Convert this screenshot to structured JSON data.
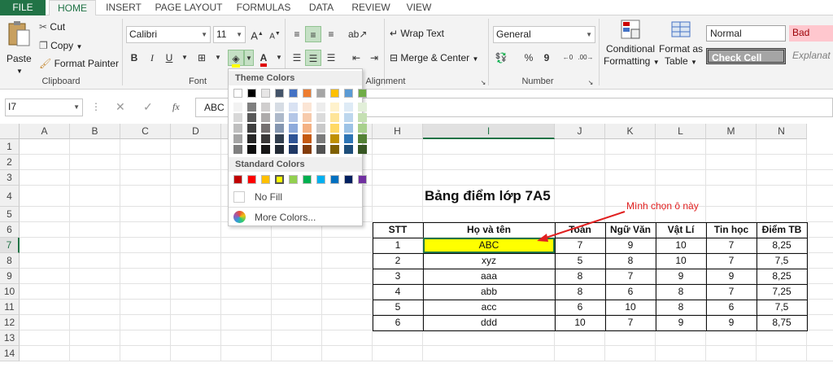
{
  "tabs": [
    "FILE",
    "HOME",
    "INSERT",
    "PAGE LAYOUT",
    "FORMULAS",
    "DATA",
    "REVIEW",
    "VIEW"
  ],
  "clipboard": {
    "paste": "Paste",
    "cut": "Cut",
    "copy": "Copy",
    "format_painter": "Format Painter",
    "label": "Clipboard"
  },
  "font": {
    "name": "Calibri",
    "size": "11",
    "bold": "B",
    "italic": "I",
    "underline": "U",
    "label": "Font",
    "grow": "A",
    "shrink": "A"
  },
  "alignment": {
    "wrap": "Wrap Text",
    "merge": "Merge & Center",
    "label": "Alignment"
  },
  "number": {
    "format": "General",
    "percent": "%",
    "comma": "9",
    "label": "Number"
  },
  "styles": {
    "conditional": "Conditional",
    "conditional2": "Formatting",
    "format_as": "Format as",
    "format_as2": "Table",
    "normal": "Normal",
    "bad": "Bad",
    "check_cell": "Check Cell",
    "explanatory": "Explanat"
  },
  "formula_bar": {
    "name_box": "I7",
    "fx": "fx",
    "value": "ABC"
  },
  "columns": [
    "A",
    "B",
    "C",
    "D",
    "E",
    "F",
    "G",
    "H",
    "I",
    "J",
    "K",
    "L",
    "M",
    "N"
  ],
  "rows": [
    "1",
    "2",
    "3",
    "4",
    "5",
    "6",
    "7",
    "8",
    "9",
    "10",
    "11",
    "12",
    "13",
    "14"
  ],
  "sheet": {
    "title": "Bảng điểm lớp 7A5",
    "annotation": "Mình chọn ô này",
    "headers": [
      "STT",
      "Họ và tên",
      "Toán",
      "Ngữ Văn",
      "Vật Lí",
      "Tin học",
      "Điểm TB"
    ],
    "rows": [
      [
        "1",
        "ABC",
        "7",
        "9",
        "10",
        "7",
        "8,25"
      ],
      [
        "2",
        "xyz",
        "5",
        "8",
        "10",
        "7",
        "7,5"
      ],
      [
        "3",
        "aaa",
        "8",
        "7",
        "9",
        "9",
        "8,25"
      ],
      [
        "4",
        "abb",
        "8",
        "6",
        "8",
        "7",
        "7,25"
      ],
      [
        "5",
        "acc",
        "6",
        "10",
        "8",
        "6",
        "7,5"
      ],
      [
        "6",
        "ddd",
        "10",
        "7",
        "9",
        "9",
        "8,75"
      ]
    ]
  },
  "color_menu": {
    "theme_label": "Theme Colors",
    "standard_label": "Standard Colors",
    "no_fill": "No Fill",
    "more_colors": "More Colors...",
    "theme_top": [
      "#ffffff",
      "#000000",
      "#e7e6e6",
      "#44546a",
      "#4472c4",
      "#ed7d31",
      "#a5a5a5",
      "#ffc000",
      "#5b9bd5",
      "#70ad47"
    ],
    "theme_shades": [
      [
        "#f2f2f2",
        "#7f7f7f",
        "#d0cece",
        "#d6dce4",
        "#d9e2f3",
        "#fbe5d5",
        "#ededed",
        "#fff2cc",
        "#deebf6",
        "#e2efd9"
      ],
      [
        "#d8d8d8",
        "#595959",
        "#aeabab",
        "#adb9ca",
        "#b4c6e7",
        "#f7cbac",
        "#dbdbdb",
        "#fee599",
        "#bdd7ee",
        "#c5e0b3"
      ],
      [
        "#bfbfbf",
        "#3f3f3f",
        "#757070",
        "#8496b0",
        "#8eaadb",
        "#f4b183",
        "#c9c9c9",
        "#ffd965",
        "#9dc3e6",
        "#a8d08d"
      ],
      [
        "#a5a5a5",
        "#262626",
        "#3a3838",
        "#323f4f",
        "#2f5496",
        "#c55a11",
        "#7b7b7b",
        "#bf9000",
        "#2e75b5",
        "#538135"
      ],
      [
        "#7f7f7f",
        "#0c0c0c",
        "#171616",
        "#222a35",
        "#1f3864",
        "#833c0b",
        "#525252",
        "#7f6000",
        "#1e4e79",
        "#375623"
      ]
    ],
    "standard": [
      "#c00000",
      "#ff0000",
      "#ffc000",
      "#ffff00",
      "#92d050",
      "#00b050",
      "#00b0f0",
      "#0070c0",
      "#002060",
      "#7030a0"
    ]
  },
  "colors": {
    "excel_green": "#217346",
    "highlight": "#ffff00",
    "annotation": "#e02020"
  }
}
